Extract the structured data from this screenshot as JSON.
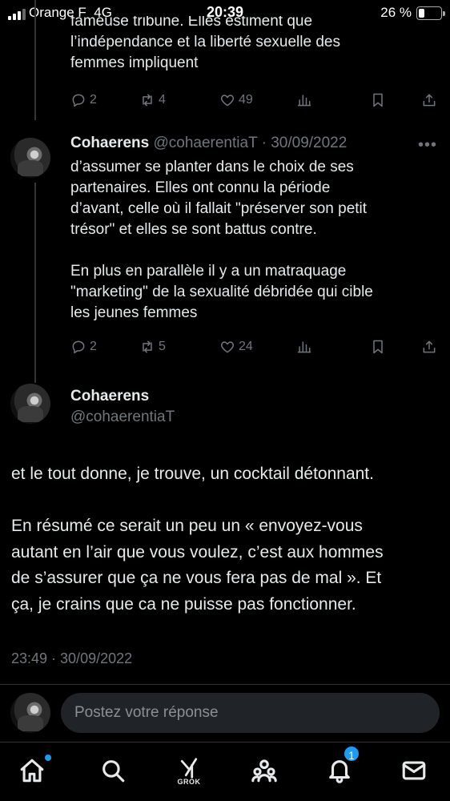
{
  "status_bar": {
    "carrier": "Orange F",
    "network": "4G",
    "time": "20:39",
    "battery_percent": "26 %",
    "battery_level": 0.26
  },
  "tweet1": {
    "text": "fameuse tribune. Elles estiment que\nl’indépendance et la liberté sexuelle des\nfemmes impliquent",
    "replies": "2",
    "retweets": "4",
    "likes": "49"
  },
  "tweet2": {
    "author_name": "Cohaerens",
    "author_meta": "@cohaerentiaT · 30/09/2022",
    "text": "d’assumer se planter dans le choix de ses\npartenaires. Elles ont connu la période\nd’avant, celle où il fallait \"préserver son petit\ntrésor\" et elles se sont battus contre.\n\nEn plus en parallèle il y a un matraquage\n\"marketing\" de la sexualité débridée qui cible\nles jeunes femmes",
    "replies": "2",
    "retweets": "5",
    "likes": "24"
  },
  "main_tweet": {
    "author_name": "Cohaerens",
    "author_handle": "@cohaerentiaT",
    "text": "et le tout donne, je trouve, un cocktail détonnant.\n\nEn résumé ce serait un peu un « envoyez-vous\nautant en l’air que vous voulez, c’est aux hommes\nde s’assurer que ça ne vous fera pas de mal ». Et\nça, je crains que ca ne puisse pas fonctionner.",
    "timestamp": "23:49 · 30/09/2022"
  },
  "reply_bar": {
    "placeholder": "Postez votre réponse"
  },
  "nav": {
    "grok_label": "GROK",
    "notifications_badge": "1"
  },
  "icons": [
    "reply-icon",
    "retweet-icon",
    "heart-icon",
    "views-icon",
    "bookmark-icon",
    "share-icon",
    "more-icon",
    "home-icon",
    "search-icon",
    "grok-icon",
    "communities-icon",
    "notifications-icon",
    "messages-icon"
  ],
  "colors": {
    "accent": "#1d9bf0",
    "muted": "#71767b",
    "background": "#000000",
    "text": "#e7e9ea"
  }
}
